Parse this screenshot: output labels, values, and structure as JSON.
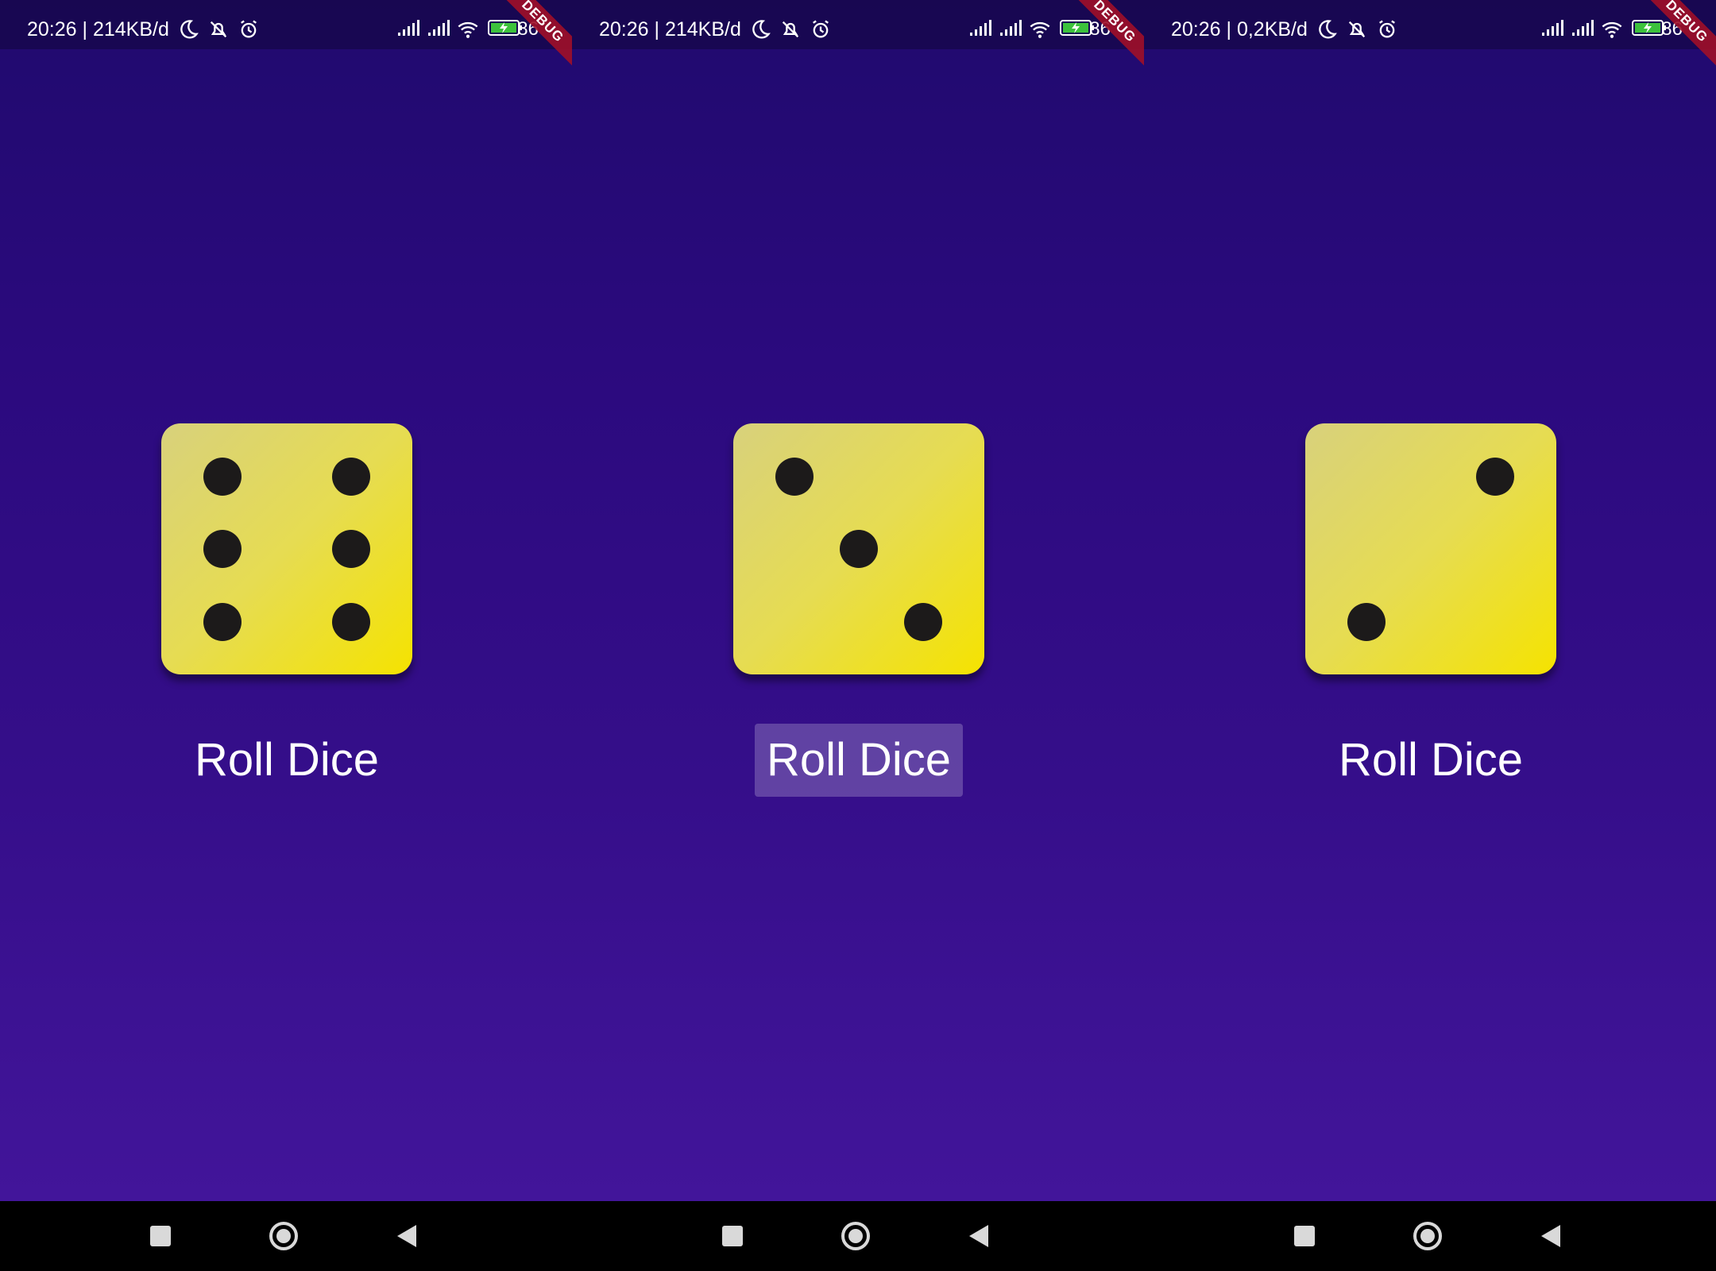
{
  "screens": [
    {
      "status": {
        "time_speed": "20:26 | 214KB/d",
        "battery_text": "86"
      },
      "debug_label": "DEBUG",
      "die_face": 6,
      "button_label": "Roll Dice",
      "button_pressed": false
    },
    {
      "status": {
        "time_speed": "20:26 | 214KB/d",
        "battery_text": "86"
      },
      "debug_label": "DEBUG",
      "die_face": 3,
      "button_label": "Roll Dice",
      "button_pressed": true
    },
    {
      "status": {
        "time_speed": "20:26 | 0,2KB/d",
        "battery_text": "86"
      },
      "debug_label": "DEBUG",
      "die_face": 2,
      "button_label": "Roll Dice",
      "button_pressed": false
    }
  ],
  "status_icons": [
    "moon-icon",
    "notifications-off-icon",
    "alarm-icon",
    "signal-icon",
    "signal-icon",
    "wifi-icon",
    "battery-charging-icon"
  ],
  "nav_icons": [
    "recents-square-icon",
    "home-circle-icon",
    "back-triangle-icon"
  ],
  "colors": {
    "background_top": "#200a6e",
    "background_bottom": "#42159a",
    "die_face": "#f5e300",
    "pip": "#1c1a1a",
    "debug_ribbon": "#a01028",
    "text": "#ffffff"
  }
}
